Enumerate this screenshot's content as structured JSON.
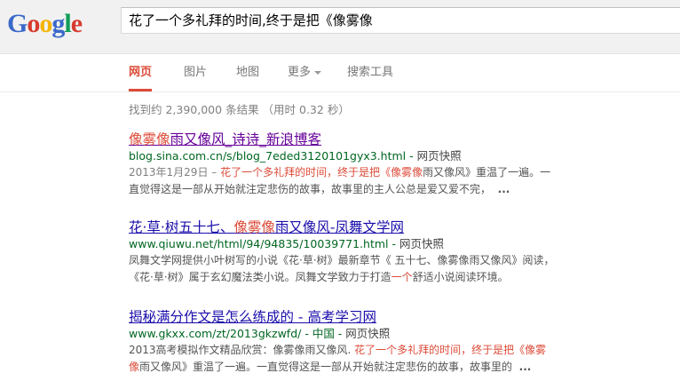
{
  "logo": {
    "letters": [
      "G",
      "o",
      "o",
      "g",
      "l",
      "e"
    ],
    "colors": [
      "#3a69c9",
      "#d63c2e",
      "#f5b400",
      "#3a69c9",
      "#109d58",
      "#d63c2e"
    ]
  },
  "search": {
    "query": "花了一个多礼拜的时间,终于是把《像雾像"
  },
  "tabs": [
    {
      "label": "网页",
      "active": true
    },
    {
      "label": "图片"
    },
    {
      "label": "地图"
    },
    {
      "label": "更多"
    },
    {
      "label": "搜索工具"
    }
  ],
  "stats": "找到约 2,390,000 条结果 （用时 0.32 秒）",
  "results": [
    {
      "title_hl": "像雾像",
      "title_rest": "雨又像风_诗诗_新浪博客",
      "url": "blog.sina.com.cn/s/blog_7eded3120101gyx3.html",
      "cache": "网页快照",
      "date": "2013年1月29日 –",
      "line1_hl": "花了一个多礼拜的时间，终于是把《像雾像",
      "line1_rest": "雨又像风》重温了一遍。一",
      "line2": "直觉得这是一部从开始就注定悲伤的故事，故事里的主人公总是爱又爱不完，",
      "ellipsis": "..."
    },
    {
      "title_pre": "花·草·树五十七、",
      "title_hl": "像雾像",
      "title_rest": "雨又像风-凤舞文学网",
      "url": "www.qiuwu.net/html/94/94835/10039771.html",
      "cache": "网页快照",
      "line1": "凤舞文学网提供小叶树写的小说《花·草·树》最新章节《 五十七、像雾像雨又像风》阅读，",
      "line2_pre": "《花·草·树》属于玄幻魔法类小说。凤舞文学致力于打造",
      "line2_hl": "一个",
      "line2_rest": "舒适小说阅读环境。"
    },
    {
      "title": "揭秘满分作文是怎么练成的 - 高考学习网",
      "url": "www.gkxx.com/zt/2013gkzwfd/",
      "url_suffix": "中国",
      "cache": "网页快照",
      "line1_pre": "2013高考模拟作文精品欣赏：像雾像雨又像风. ",
      "line1_hl": "花了一个多礼拜的时间，终于是把《像雾",
      "line2_hl": "像",
      "line2_rest": "雨又像风》重温了一遍。一直觉得这是一部从开始就注定悲伤的故事，故事里的",
      "ellipsis": "..."
    }
  ]
}
